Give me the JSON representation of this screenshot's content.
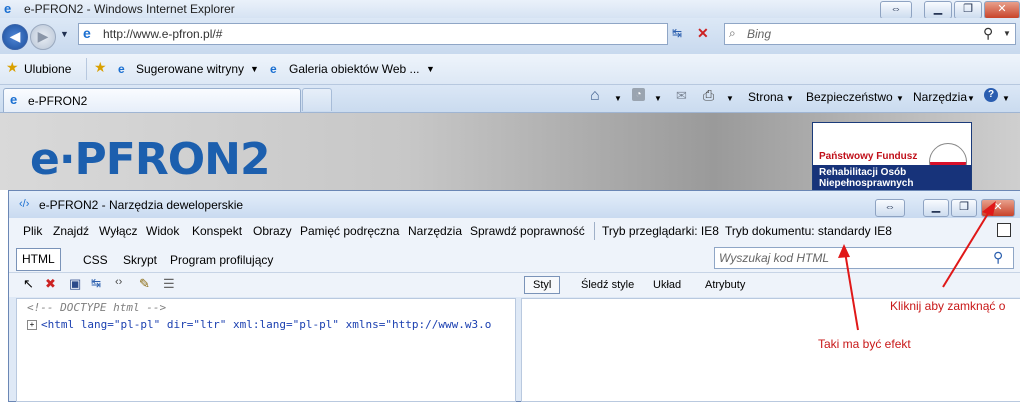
{
  "browser": {
    "window_title": "e-PFRON2 - Windows Internet Explorer",
    "address": "http://www.e-pfron.pl/#",
    "search_placeholder": "Bing",
    "favorites_label": "Ulubione",
    "fav_items": [
      "Sugerowane witryny",
      "Galeria obiektów Web ..."
    ],
    "tab_title": "e-PFRON2",
    "commands": [
      "Strona",
      "Bezpieczeństwo",
      "Narzędzia"
    ]
  },
  "page": {
    "logo": "e·PFRON2",
    "fund_red": "Państwowy Fundusz",
    "fund_blue_1": "Rehabilitacji Osób",
    "fund_blue_2": "Niepełnosprawnych"
  },
  "devtools": {
    "title": "e-PFRON2 - Narzędzia deweloperskie",
    "menu": [
      "Plik",
      "Znajdź",
      "Wyłącz",
      "Widok",
      "Konspekt",
      "Obrazy",
      "Pamięć podręczna",
      "Narzędzia",
      "Sprawdź poprawność"
    ],
    "browser_mode": "Tryb przeglądarki: IE8",
    "document_mode": "Tryb dokumentu: standardy IE8",
    "tabs": [
      "HTML",
      "CSS",
      "Skrypt",
      "Program profilujący"
    ],
    "code_search_placeholder": "Wyszukaj kod HTML",
    "right_tabs": [
      "Styl",
      "Śledź style",
      "Układ",
      "Atrybuty"
    ],
    "tree": {
      "doctype": "<!-- DOCTYPE html -->",
      "html_line": "<html lang=\"pl-pl\" dir=\"ltr\" xml:lang=\"pl-pl\" xmlns=\"http://www.w3.o"
    }
  },
  "annotations": {
    "close_hint": "Kliknij aby zamknąć o",
    "effect_hint": "Taki ma być efekt",
    "color": "#c81818"
  }
}
